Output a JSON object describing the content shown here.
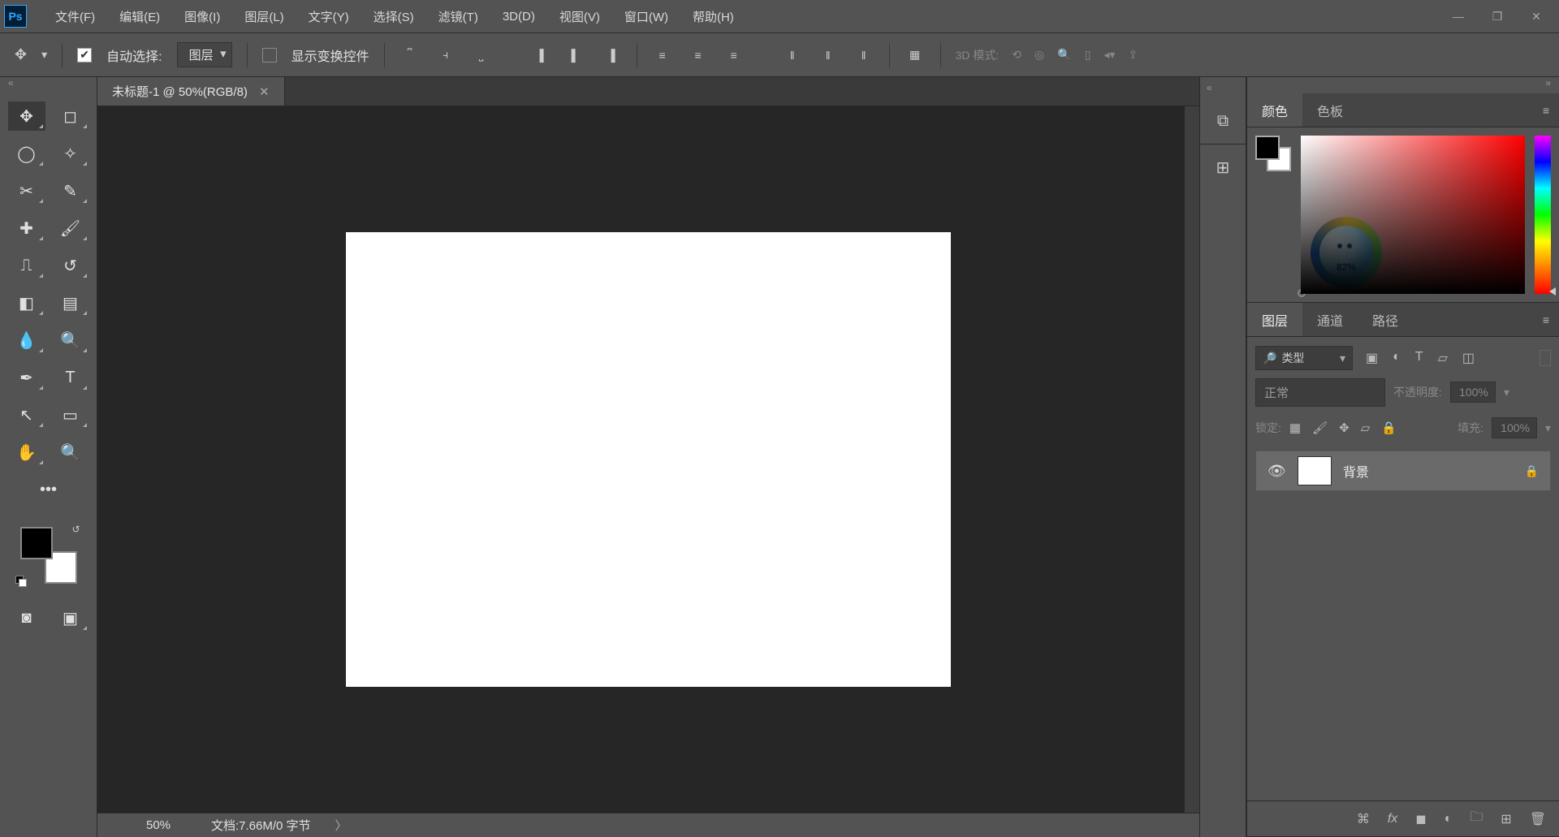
{
  "app": {
    "logo": "Ps"
  },
  "menu": {
    "file": "文件(F)",
    "edit": "编辑(E)",
    "image": "图像(I)",
    "layer": "图层(L)",
    "type": "文字(Y)",
    "select": "选择(S)",
    "filter": "滤镜(T)",
    "threeD": "3D(D)",
    "view": "视图(V)",
    "window": "窗口(W)",
    "help": "帮助(H)"
  },
  "options": {
    "autoSelect": "自动选择:",
    "layerSelect": "图层",
    "showTransform": "显示变换控件",
    "mode3d": "3D 模式:"
  },
  "doc": {
    "tabTitle": "未标题-1 @ 50%(RGB/8)"
  },
  "status": {
    "zoom": "50%",
    "docInfo": "文档:7.66M/0 字节"
  },
  "colorPanel": {
    "tabColor": "颜色",
    "tabSwatches": "色板"
  },
  "bubble": {
    "pct": "82%"
  },
  "layersPanel": {
    "tabLayers": "图层",
    "tabChannels": "通道",
    "tabPaths": "路径",
    "typeLabel": "类型",
    "blendMode": "正常",
    "opacityLabel": "不透明度:",
    "opacityValue": "100%",
    "lockLabel": "锁定:",
    "fillLabel": "填充:",
    "fillValue": "100%",
    "layer1": "背景"
  }
}
